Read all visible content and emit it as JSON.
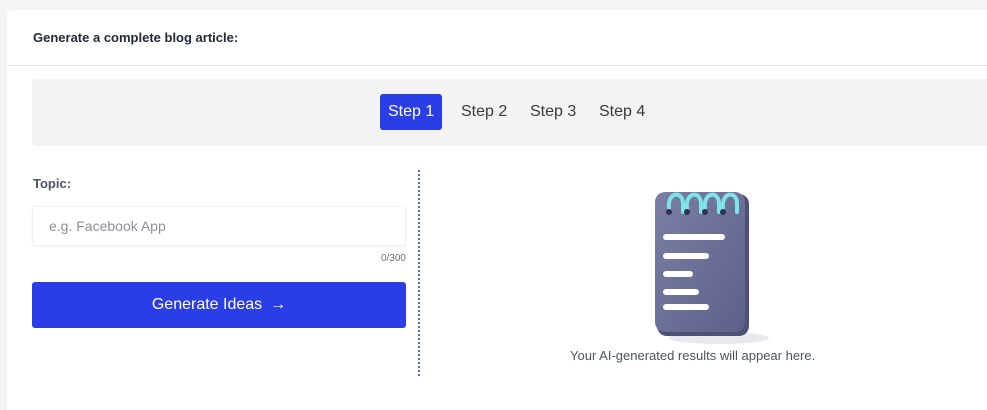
{
  "card": {
    "title": "Generate a complete blog article:"
  },
  "steps": [
    {
      "label": "Step 1",
      "active": true
    },
    {
      "label": "Step 2",
      "active": false
    },
    {
      "label": "Step 3",
      "active": false
    },
    {
      "label": "Step 4",
      "active": false
    }
  ],
  "form": {
    "topic_label": "Topic:",
    "topic_placeholder": "e.g. Facebook App",
    "topic_value": "",
    "char_count": "0/300",
    "generate_label": "Generate Ideas",
    "generate_arrow": "→"
  },
  "results": {
    "empty_message": "Your AI-generated results will appear here.",
    "illustration_icon": "notepad-icon"
  },
  "colors": {
    "accent": "#2b3de6",
    "steps_bg": "#f3f3f3",
    "divider": "#5b6fb8"
  }
}
